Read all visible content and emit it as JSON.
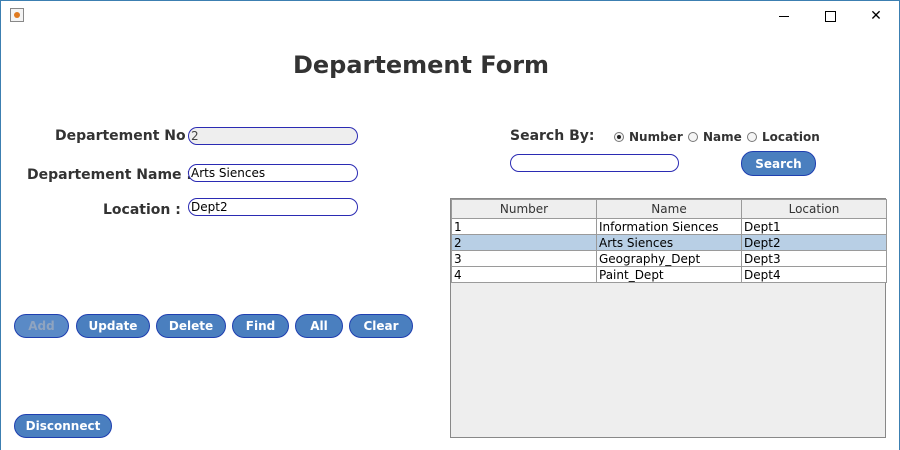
{
  "window": {
    "controls": [
      "minimize",
      "maximize",
      "close"
    ]
  },
  "form": {
    "title": "Departement Form",
    "dept_no": {
      "label": "Departement No :",
      "value": "2"
    },
    "dept_name": {
      "label": "Departement Name :",
      "value": "Arts Siences"
    },
    "location": {
      "label": "Location :",
      "value": "Dept2"
    }
  },
  "buttons": {
    "add": "Add",
    "update": "Update",
    "delete": "Delete",
    "find": "Find",
    "all": "All",
    "clear": "Clear",
    "disconnect": "Disconnect"
  },
  "search": {
    "label": "Search By:",
    "options": [
      {
        "label": "Number",
        "checked": true
      },
      {
        "label": "Name",
        "checked": false
      },
      {
        "label": "Location",
        "checked": false
      }
    ],
    "value": "",
    "button": "Search"
  },
  "table": {
    "columns": [
      "Number",
      "Name",
      "Location"
    ],
    "rows": [
      [
        "1",
        "Information Siences",
        "Dept1"
      ],
      [
        "2",
        "Arts Siences",
        "Dept2"
      ],
      [
        "3",
        "Geography_Dept",
        "Dept3"
      ],
      [
        "4",
        "Paint_Dept",
        "Dept4"
      ]
    ],
    "selected_row": 1
  },
  "colors": {
    "button_bg": "#4a7fbf",
    "border": "#1f3fb0",
    "selection": "#b8cfe5"
  }
}
